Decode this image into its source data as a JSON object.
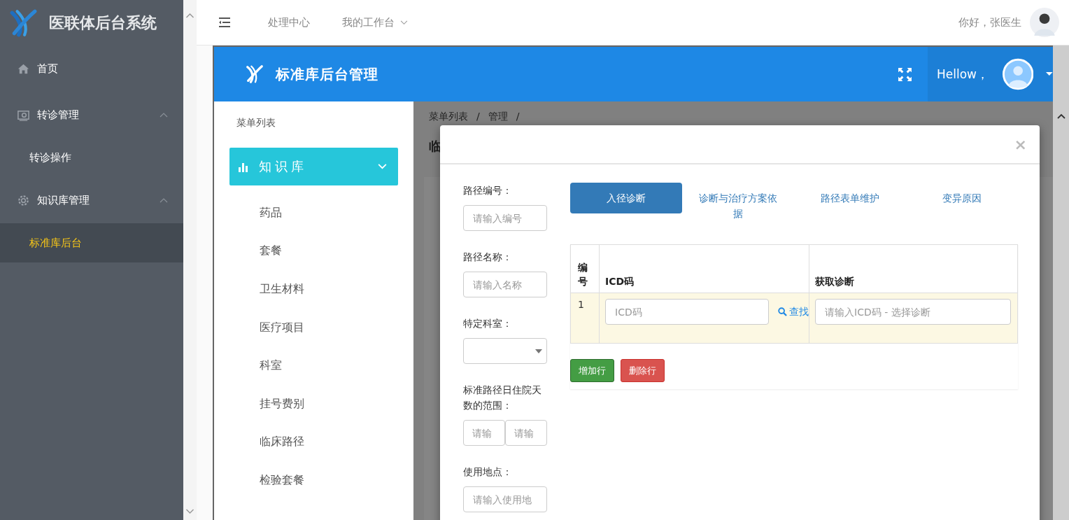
{
  "app": {
    "title": "医联体后台系统"
  },
  "sidebar": {
    "items": [
      {
        "kind": "link",
        "label": "首页",
        "selected": false
      },
      {
        "kind": "group",
        "label": "转诊管理",
        "selected": false,
        "expanded": true,
        "children": [
          {
            "label": "转诊操作",
            "selected": false
          }
        ]
      },
      {
        "kind": "group",
        "label": "知识库管理",
        "selected": false,
        "expanded": true,
        "children": [
          {
            "label": "标准库后台",
            "selected": true
          }
        ]
      }
    ]
  },
  "topbar": {
    "nav": [
      {
        "label": "处理中心",
        "dropdown": false
      },
      {
        "label": "我的工作台",
        "dropdown": true
      }
    ],
    "greeting": "你好，张医生"
  },
  "inner": {
    "title": "标准库后台管理",
    "greeting": "Hellow，",
    "menu": {
      "heading": "菜单列表",
      "group": {
        "label": "知识库",
        "expanded": true,
        "items": [
          "药品",
          "套餐",
          "卫生材料",
          "医疗项目",
          "科室",
          "挂号费别",
          "临床路径",
          "检验套餐"
        ]
      }
    },
    "page": {
      "breadcrumb": [
        "菜单列表",
        "管理"
      ],
      "separator": "/",
      "title": "临"
    }
  },
  "modal": {
    "close": "×",
    "fields": [
      {
        "kind": "text",
        "label": "路径编号：",
        "placeholder": "请输入编号"
      },
      {
        "kind": "text",
        "label": "路径名称：",
        "placeholder": "请输入名称"
      },
      {
        "kind": "select",
        "label": "特定科室："
      },
      {
        "kind": "range",
        "label": "标准路径日住院天数的范围：",
        "placeholders": [
          "请输",
          "请输"
        ]
      },
      {
        "kind": "text",
        "label": "使用地点：",
        "placeholder": "请输入使用地"
      }
    ],
    "tabs": [
      {
        "label": "入径诊断",
        "selected": true
      },
      {
        "label": "诊断与治疗方案依据",
        "selected": false
      },
      {
        "label": "路径表单维护",
        "selected": false
      },
      {
        "label": "变异原因",
        "selected": false
      }
    ],
    "table": {
      "columns": [
        "编号",
        "ICD码",
        "获取诊断"
      ],
      "rows": [
        {
          "number": "1",
          "icd_placeholder": "ICD码",
          "search_label": "查找",
          "diagnosis_placeholder": "请输入ICD码 - 选择诊断"
        }
      ]
    },
    "buttons": [
      {
        "kind": "add",
        "label": "增加行"
      },
      {
        "kind": "delete",
        "label": "删除行"
      }
    ]
  }
}
